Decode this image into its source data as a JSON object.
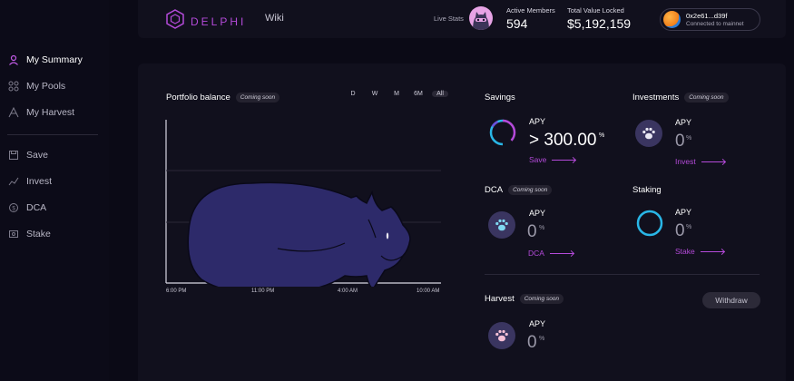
{
  "header": {
    "logo_text": "DELPHI",
    "wiki": "Wiki",
    "live_stats": "Live Stats",
    "active_members_label": "Active Members",
    "active_members_value": "594",
    "tvl_label": "Total Value Locked",
    "tvl_value": "$5,192,159",
    "wallet_address": "0x2e61...d39f",
    "wallet_network": "Connected to mainnet"
  },
  "sidebar": {
    "items": [
      {
        "label": "My Summary",
        "icon": "user-icon"
      },
      {
        "label": "My Pools",
        "icon": "pools-icon"
      },
      {
        "label": "My Harvest",
        "icon": "harvest-icon"
      },
      {
        "label": "Save",
        "icon": "save-icon"
      },
      {
        "label": "Invest",
        "icon": "invest-icon"
      },
      {
        "label": "DCA",
        "icon": "dca-icon"
      },
      {
        "label": "Stake",
        "icon": "stake-icon"
      }
    ]
  },
  "portfolio": {
    "title": "Portfolio balance",
    "badge": "Coming soon",
    "timeframes": [
      "D",
      "W",
      "M",
      "6M",
      "All"
    ],
    "selected": "All",
    "x_ticks": [
      "6:00 PM",
      "11:00 PM",
      "4:00 AM",
      "10:00 AM"
    ]
  },
  "savings": {
    "title": "Savings",
    "apy_label": "APY",
    "apy_value": "> 300.00",
    "pct": "%",
    "action": "Save"
  },
  "investments": {
    "title": "Investments",
    "badge": "Coming soon",
    "apy_label": "APY",
    "apy_value": "0",
    "pct": "%",
    "action": "Invest"
  },
  "dca": {
    "title": "DCA",
    "badge": "Coming soon",
    "apy_label": "APY",
    "apy_value": "0",
    "pct": "%",
    "action": "DCA"
  },
  "staking": {
    "title": "Staking",
    "apy_label": "APY",
    "apy_value": "0",
    "pct": "%",
    "action": "Stake"
  },
  "harvest": {
    "title": "Harvest",
    "badge": "Coming soon",
    "apy_label": "APY",
    "apy_value": "0",
    "pct": "%",
    "withdraw": "Withdraw"
  },
  "colors": {
    "accent": "#b44ad9",
    "bg": "#0b0a16",
    "panel": "#11101d",
    "cyan": "#29b6e6",
    "cat": "#2d2a6a"
  }
}
